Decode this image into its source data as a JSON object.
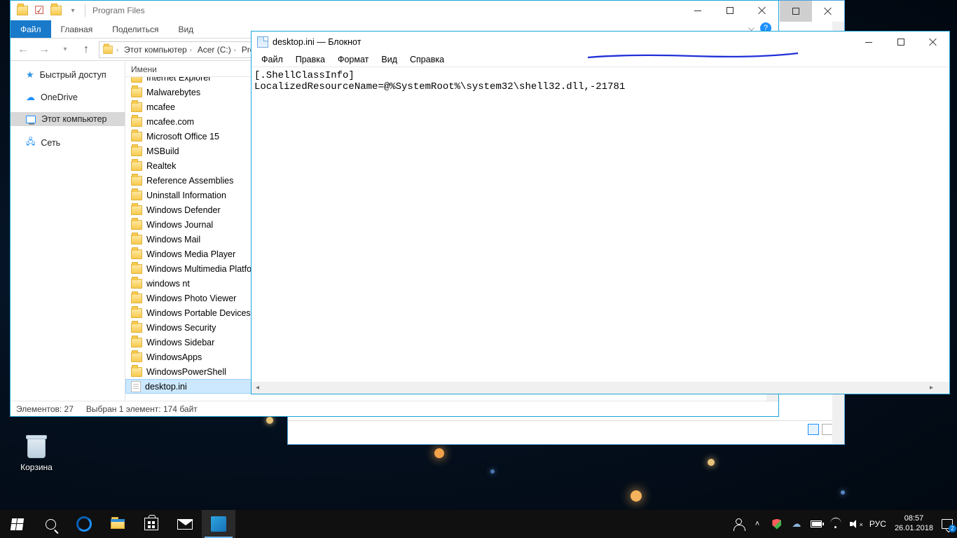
{
  "explorer": {
    "title": "Program Files",
    "ribbon": {
      "file": "Файл",
      "tabs": [
        "Главная",
        "Поделиться",
        "Вид"
      ]
    },
    "breadcrumbs": [
      "Этот компьютер",
      "Acer (C:)",
      "Pro"
    ],
    "nav": [
      {
        "label": "Быстрый доступ",
        "icon": "star"
      },
      {
        "label": "OneDrive",
        "icon": "onedrive"
      },
      {
        "label": "Этот компьютер",
        "icon": "pc",
        "selected": true
      },
      {
        "label": "Сеть",
        "icon": "net"
      }
    ],
    "column": "Имени",
    "files": [
      "Internet Explorer",
      "Malwarebytes",
      "mcafee",
      "mcafee.com",
      "Microsoft Office 15",
      "MSBuild",
      "Realtek",
      "Reference Assemblies",
      "Uninstall Information",
      "Windows Defender",
      "Windows Journal",
      "Windows Mail",
      "Windows Media Player",
      "Windows Multimedia Platform",
      "windows nt",
      "Windows Photo Viewer",
      "Windows Portable Devices",
      "Windows Security",
      "Windows Sidebar",
      "WindowsApps",
      "WindowsPowerShell"
    ],
    "selected_file": "desktop.ini",
    "status": {
      "count": "Элементов: 27",
      "sel": "Выбран 1 элемент: 174 байт"
    }
  },
  "notepad": {
    "title": "desktop.ini — Блокнот",
    "menu": [
      "Файл",
      "Правка",
      "Формат",
      "Вид",
      "Справка"
    ],
    "content": "[.ShellClassInfo]\nLocalizedResourceName=@%SystemRoot%\\system32\\shell32.dll,-21781"
  },
  "desktop": {
    "recycle": "Корзина"
  },
  "taskbar": {
    "lang": "РУС",
    "time": "08:57",
    "date": "26.01.2018",
    "badge": "2"
  }
}
